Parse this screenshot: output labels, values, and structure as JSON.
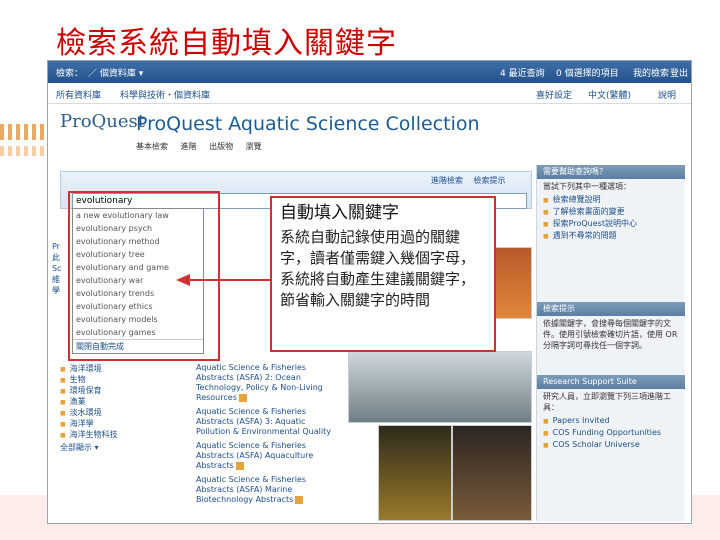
{
  "slide": {
    "title": "檢索系統自動填入關鍵字"
  },
  "topbar": {
    "search_label": "檢索：",
    "db_menu": "／ 個資料庫 ▾",
    "recent_searches": "4 最近查詢",
    "marked_items": "0 個選擇的項目",
    "my_research": "我的檢索",
    "logout": "登出"
  },
  "subbar": {
    "all_databases": "所有資料庫",
    "subjects": "科學與技術・個資料庫",
    "prefs": "喜好設定",
    "language": "中文(繁體)",
    "help": "說明"
  },
  "brand": {
    "logo": "ProQuest",
    "title": "ProQuest Aquatic Science Collection"
  },
  "modes": {
    "basic": "基本檢索",
    "advanced": "進階",
    "publications": "出版物",
    "browse": "瀏覽"
  },
  "search": {
    "adv_link": "進階檢索",
    "tips_link": "檢索提示",
    "value": "evolutionary"
  },
  "autocomplete": {
    "suggestions": [
      "a new evolutionary law",
      "evolutionary psych",
      "evolutionary method",
      "evolutionary tree",
      "evolutionary and game",
      "evolutionary war",
      "evolutionary trends",
      "evolutionary ethics",
      "evolutionary models",
      "evolutionary games"
    ],
    "close_label": "關閉自動完成"
  },
  "left_partial": [
    "Pr",
    "此",
    "Sc",
    "維",
    "學"
  ],
  "subjects": [
    "海洋環境",
    "生物",
    "環境保育",
    "漁業",
    "淡水環境",
    "海洋學",
    "海洋生物科技"
  ],
  "subjects_more": "全部顯示 ▾",
  "collections": [
    {
      "line1": "Aquatic Science & Fisheries",
      "line2": "Abstracts (ASFA) 2: Ocean",
      "line3": "Technology, Policy & Non-Living",
      "line4": "Resources"
    },
    {
      "line1": "Aquatic Science & Fisheries",
      "line2": "Abstracts (ASFA) 3: Aquatic",
      "line3": "Pollution & Environmental Quality",
      "line4": ""
    },
    {
      "line1": "Aquatic Science & Fisheries",
      "line2": "Abstracts (ASFA) Aquaculture",
      "line3": "Abstracts",
      "line4": ""
    },
    {
      "line1": "Aquatic Science & Fisheries",
      "line2": "Abstracts (ASFA) Marine",
      "line3": "Biotechnology Abstracts",
      "line4": ""
    }
  ],
  "sidebar": {
    "help_title": "需要幫助查詢嗎？",
    "help_intro": "嘗試下列其中一種選項：",
    "help_links": [
      "檢索總覽說明",
      "了解檢索畫面的變更",
      "探索ProQuest說明中心",
      "遇到不尋常的問題"
    ],
    "tips_title": "檢索提示",
    "tips_text": "依據關鍵字，會搜尋每個關鍵字的文件。使用引號檢索確切片語，使用 OR 分隔字詞可尋找任一個字詞。",
    "support_title": "Research Support Suite",
    "support_text": "研究人員，立即瀏覽下列三項進階工具：",
    "support_links": [
      "Papers Invited",
      "COS Funding Opportunities",
      "COS Scholar Universe"
    ]
  },
  "callout": {
    "title": "自動填入關鍵字",
    "body": "系統自動記錄使用過的關鍵字，讀者僅需鍵入幾個字母，系統將自動產生建議關鍵字，節省輸入關鍵字的時間"
  },
  "colors": {
    "title_red": "#cc0000",
    "topbar_blue": "#24528c",
    "accent_orange": "#e8a23a",
    "callout_border": "#d03030"
  }
}
